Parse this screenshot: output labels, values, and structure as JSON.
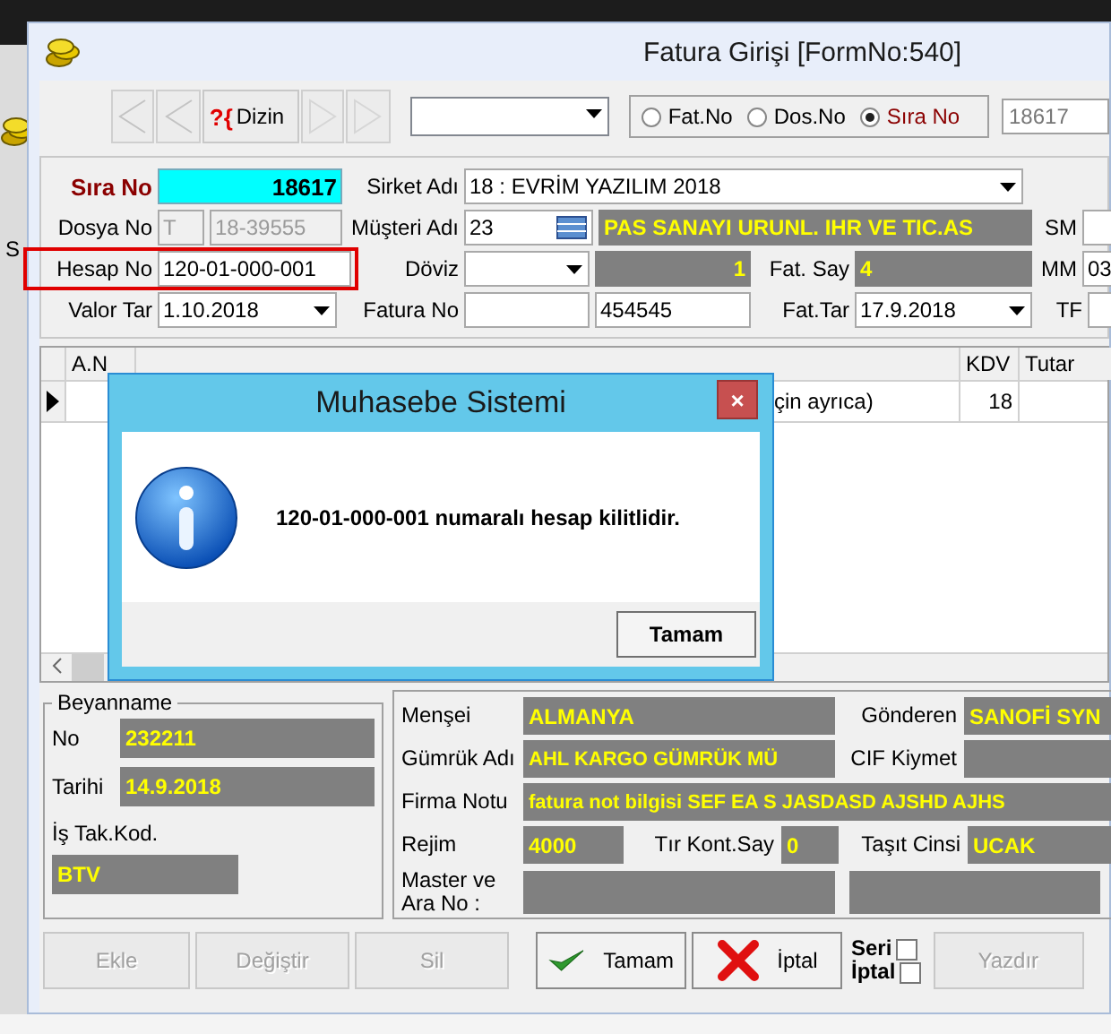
{
  "background_window": {
    "letter": "S"
  },
  "window": {
    "title": "Fatura Girişi [FormNo:540]"
  },
  "toolbar": {
    "back_buttons": [
      {
        "disabled": true
      },
      {
        "disabled": true
      }
    ],
    "dizin": {
      "glyph": "?{",
      "label": "Dizin"
    },
    "forward_buttons": [
      {
        "disabled": true
      },
      {
        "disabled": true
      }
    ],
    "search_by": [
      {
        "label": "Fat.No",
        "selected": false
      },
      {
        "label": "Dos.No",
        "selected": false
      },
      {
        "label": "Sıra No",
        "selected": true
      }
    ],
    "search_value": "18617"
  },
  "form": {
    "sira_no": {
      "label": "Sıra No",
      "value": "18617"
    },
    "sirket": {
      "label": "Sirket Adı",
      "value": "18 : EVRİM YAZILIM 2018"
    },
    "dosya_no": {
      "label": "Dosya No",
      "prefix": "T",
      "value": "18-39555",
      "disabled": true
    },
    "musteri": {
      "label": "Müşteri Adı",
      "code": "23",
      "name": "PAS SANAYI URUNL. IHR VE TIC.AS"
    },
    "sm": {
      "label": "SM"
    },
    "hesap_no": {
      "label": "Hesap No",
      "value": "120-01-000-001",
      "highlighted": true
    },
    "doviz": {
      "label": "Döviz",
      "rate": "1"
    },
    "fat_say": {
      "label": "Fat. Say",
      "value": "4"
    },
    "mm": {
      "label": "MM",
      "value": "03"
    },
    "valor_tar": {
      "label": "Valor Tar",
      "value": "1.10.2018"
    },
    "fatura_no": {
      "label": "Fatura No",
      "value": "454545"
    },
    "fat_tar": {
      "label": "Fat.Tar",
      "value": "17.9.2018"
    },
    "tf": {
      "label": "TF"
    }
  },
  "grid": {
    "columns": [
      {
        "kind": "an",
        "label": "A.N"
      },
      {
        "kind": "desc"
      },
      {
        "kind": "kdv",
        "label": "KDV"
      },
      {
        "kind": "tutar",
        "label": "Tutar"
      }
    ],
    "rows": [
      {
        "current": true,
        "description": "çin ayrıca)",
        "kdv": "18"
      }
    ]
  },
  "dialog": {
    "title": "Muhasebe Sistemi",
    "close": "×",
    "message": "120-01-000-001 numaralı hesap kilitlidir.",
    "button": "Tamam"
  },
  "beyanname": {
    "title": "Beyanname",
    "no_label": "No",
    "no": "232211",
    "tarih_label": "Tarihi",
    "tarih": "14.9.2018",
    "is_tak_label": "İş Tak.Kod.",
    "is_tak": "BTV"
  },
  "details": {
    "mensei_label": "Menşei",
    "mensei": "ALMANYA",
    "gonderen_label": "Gönderen",
    "gonderen": "SANOFİ SYN",
    "gumruk_label": "Gümrük Adı",
    "gumruk": "AHL KARGO GÜMRÜK MÜ",
    "cif_label": "CIF Kiymet",
    "not_label": "Firma Notu",
    "not": "fatura not bilgisi SEF EA S JASDASD AJSHD AJHS",
    "rejim_label": "Rejim",
    "rejim": "4000",
    "tir_label": "Tır Kont.Say",
    "tir": "0",
    "tasit_label": "Taşıt Cinsi",
    "tasit": "UCAK",
    "master_label": "Master ve Ara No :"
  },
  "buttons": [
    {
      "kind": "plain",
      "label": "Ekle",
      "disabled": true
    },
    {
      "kind": "plain",
      "label": "Değiştir",
      "disabled": true
    },
    {
      "kind": "plain",
      "label": "Sil",
      "disabled": true
    },
    {
      "kind": "ok",
      "label": "Tamam",
      "disabled": false
    },
    {
      "kind": "cancel",
      "label": "İptal",
      "disabled": false
    }
  ],
  "seri_iptal": [
    {
      "label": "Seri",
      "checked": false
    },
    {
      "label": "İptal",
      "checked": false
    }
  ],
  "print": {
    "label": "Yazdır",
    "disabled": true
  }
}
